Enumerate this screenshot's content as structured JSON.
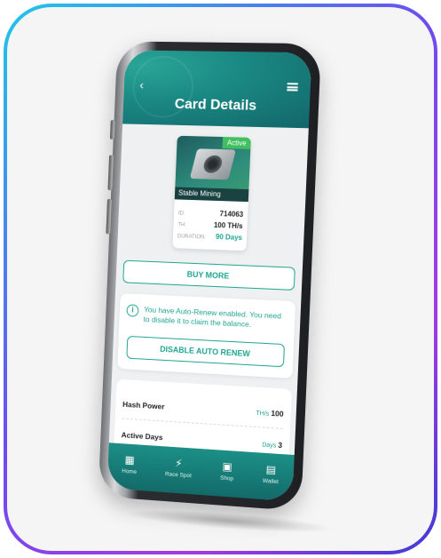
{
  "header": {
    "title": "Card Details"
  },
  "card": {
    "badge": "Active",
    "name": "Stable Mining",
    "rows": [
      {
        "key": "ID:",
        "value": "714063"
      },
      {
        "key": "TH:",
        "value": "100 TH/s"
      },
      {
        "key": "DURATION:",
        "value": "90 Days"
      }
    ]
  },
  "actions": {
    "buy_more": "BUY MORE",
    "disable_auto_renew": "DISABLE AUTO RENEW"
  },
  "notice": {
    "text": "You have Auto-Renew enabled. You need to disable it to claim the balance."
  },
  "stats": [
    {
      "label": "Hash Power",
      "unit": "TH/s",
      "value": "100"
    },
    {
      "label": "Active Days",
      "unit": "Days",
      "value": "3"
    }
  ],
  "tabbar": [
    {
      "label": "Home",
      "icon": "grid-icon"
    },
    {
      "label": "Race Spot",
      "icon": "lightning-icon"
    },
    {
      "label": "Shop",
      "icon": "shop-icon"
    },
    {
      "label": "Wallet",
      "icon": "wallet-icon"
    }
  ],
  "colors": {
    "accent": "#1fa590",
    "header_dark": "#12666a",
    "active_badge": "#3fbf5f",
    "frame_gradient_start": "#1ec8e8",
    "frame_gradient_end": "#a33be0"
  }
}
